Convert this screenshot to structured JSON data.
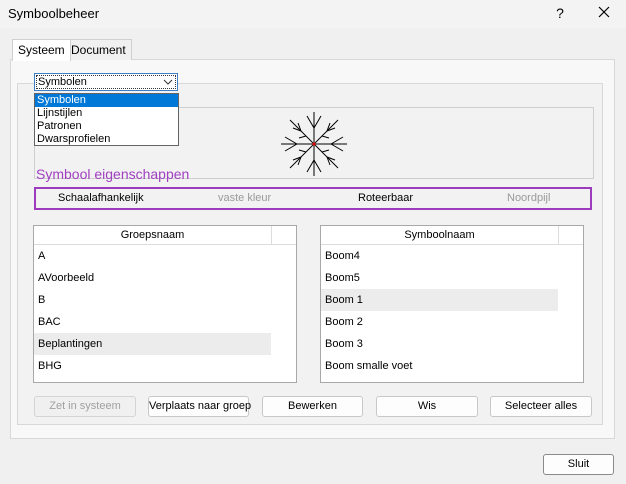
{
  "window": {
    "title": "Symboolbeheer",
    "help_label": "?"
  },
  "tabs": [
    {
      "label": "Systeem",
      "active": true
    },
    {
      "label": "Document",
      "active": false
    }
  ],
  "combo": {
    "value": "Symbolen",
    "options": [
      "Symbolen",
      "Lijnstijlen",
      "Patronen",
      "Dwarsprofielen"
    ],
    "selected_index": 0
  },
  "section_title": "Symbool eigenschappen",
  "properties": [
    {
      "label": "Schaalafhankelijk",
      "enabled": true
    },
    {
      "label": "vaste kleur",
      "enabled": false
    },
    {
      "label": "Roteerbaar",
      "enabled": true
    },
    {
      "label": "Noordpijl",
      "enabled": false
    }
  ],
  "group_list": {
    "header": "Groepsnaam",
    "items": [
      "A",
      "AVoorbeeld",
      "B",
      "BAC",
      "Beplantingen",
      "BHG"
    ],
    "highlighted_index": 4
  },
  "symbol_list": {
    "header": "Symboolnaam",
    "items": [
      "Boom4",
      "Boom5",
      "Boom 1",
      "Boom 2",
      "Boom 3",
      "Boom smalle voet"
    ],
    "highlighted_index": 2
  },
  "buttons": {
    "zet_in_systeem": "Zet in systeem",
    "verplaats": "Verplaats naar groep",
    "bewerken": "Bewerken",
    "wis": "Wis",
    "selecteer_alles": "Selecteer alles"
  },
  "close_label": "Sluit",
  "colors": {
    "accent_purple": "#9c3cbc",
    "selection_blue": "#0078d7"
  }
}
